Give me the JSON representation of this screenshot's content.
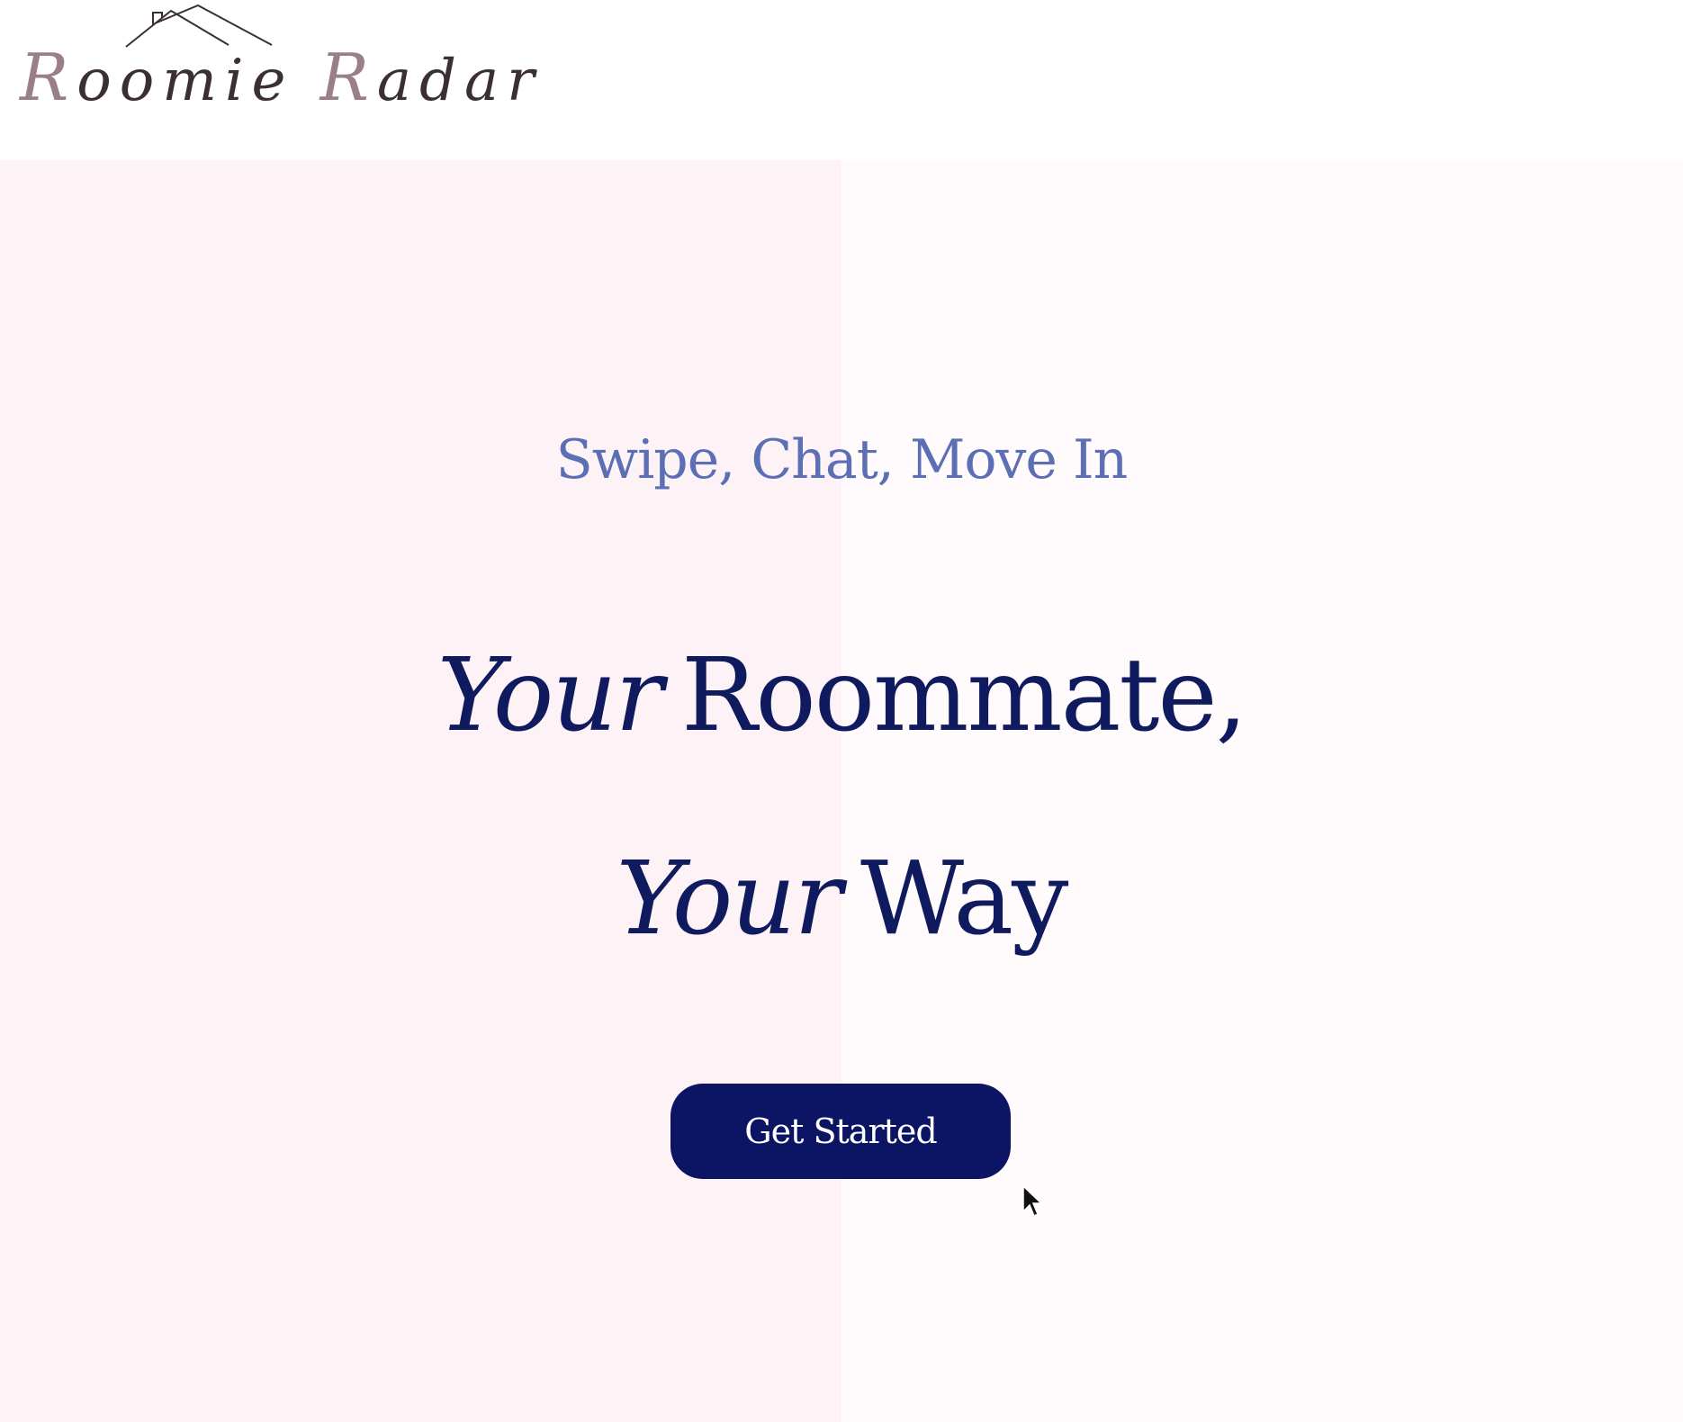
{
  "brand": {
    "name_part1_cap": "R",
    "name_part1_rest": "oomie",
    "name_part2_cap": "R",
    "name_part2_rest": "adar",
    "icon": "house-roof-icon"
  },
  "hero": {
    "tagline": "Swipe, Chat, Move In",
    "headline_line1_italic": "Your",
    "headline_line1_regular": "Roommate,",
    "headline_line2_italic": "Your",
    "headline_line2_regular": "Way",
    "cta_label": "Get Started"
  },
  "colors": {
    "tagline": "#5c6fb5",
    "headline": "#101a5e",
    "cta_background": "#0c1564",
    "hero_left_background": "#fdf3f7"
  }
}
